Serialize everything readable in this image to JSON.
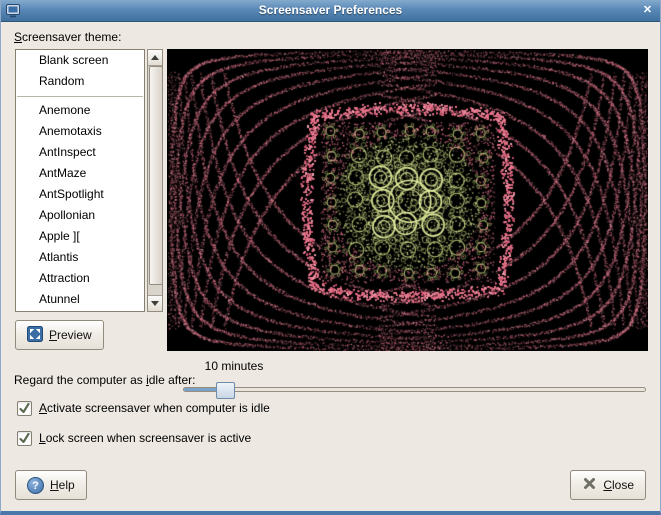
{
  "window": {
    "title": "Screensaver Preferences"
  },
  "icons": {
    "titlebar_close": "✕",
    "help_glyph": "?"
  },
  "theme_label": {
    "key": "S",
    "post": "creensaver theme:"
  },
  "list": {
    "items": [
      "Blank screen",
      "Random",
      "Anemone",
      "Anemotaxis",
      "AntInspect",
      "AntMaze",
      "AntSpotlight",
      "Apollonian",
      "Apple ][",
      "Atlantis",
      "Attraction",
      "Atunnel"
    ]
  },
  "preview_button": {
    "key": "P",
    "post": "review"
  },
  "idle_slider": {
    "label_pre": "Regard the computer as ",
    "label_key": "i",
    "label_post": "dle after:",
    "value": "10 minutes"
  },
  "checkboxes": [
    {
      "key": "A",
      "post": "ctivate screensaver when computer is idle",
      "checked": true
    },
    {
      "key": "L",
      "post": "ock screen when screensaver is active",
      "checked": true
    }
  ],
  "help_button": {
    "key": "H",
    "post": "elp"
  },
  "close_button": {
    "key": "C",
    "post": "lose"
  },
  "titlebar_color": "#4a78ab",
  "preview_colors": {
    "background": "#000000",
    "pink": "#e8798f",
    "pink_light": "#f4a7b6",
    "pink_deep": "#cc5672",
    "yellow": "#e9f2a2",
    "olive": "#b9c878",
    "olive_dark": "#8fa05c"
  }
}
